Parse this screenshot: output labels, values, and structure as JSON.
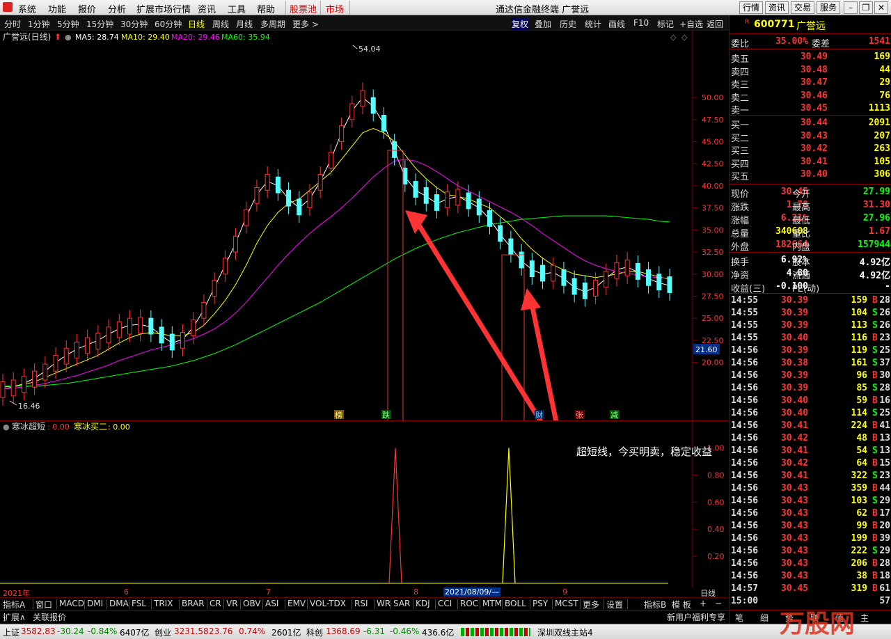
{
  "menubar": {
    "items": [
      "系统",
      "功能",
      "报价",
      "分析",
      "扩展市场行情",
      "资讯",
      "工具",
      "帮助",
      "股票池",
      "市场"
    ],
    "window_title": "通达信金融终端  广誉远",
    "right_buttons": [
      "行情",
      "资讯",
      "交易",
      "服务"
    ]
  },
  "toolbar": {
    "periods": [
      "分时",
      "1分钟",
      "5分钟",
      "15分钟",
      "30分钟",
      "60分钟",
      "日线",
      "周线",
      "月线",
      "多周期",
      "更多 >"
    ],
    "selected_period": "日线",
    "tools": [
      "复权",
      "叠加",
      "历史",
      "统计",
      "画线",
      "F10",
      "+自选",
      "返回"
    ]
  },
  "main_chart": {
    "title": "广誉远(日线)",
    "ma5": "MA5: 28.74",
    "ma10": "MA10: 29.40",
    "ma20": "MA20: 29.46",
    "ma60": "MA60: 35.94",
    "high_label": "54.04",
    "low_label": "16.46",
    "current_price_tag": "21.60",
    "time_labels": [
      "2021年",
      "6",
      "7",
      "8",
      "9"
    ],
    "event_labels": [
      "榜",
      "跌",
      "财",
      "张",
      "减"
    ],
    "annotation": "超短线，今买明卖，稳定收益",
    "date_cursor": "2021/08/09/—"
  },
  "chart_data": [
    {
      "type": "candlestick",
      "title": "广誉远(日线)",
      "ylim": [
        15,
        56
      ],
      "y_ticks": [
        20.0,
        22.5,
        25.0,
        27.5,
        30.0,
        32.5,
        35.0,
        37.5,
        40.0,
        42.5,
        45.0,
        47.5,
        50.0
      ],
      "series": [
        {
          "name": "MA5",
          "values": [
            17.0,
            17.2,
            17.6,
            18.2,
            19.0,
            20.0,
            20.8,
            21.5,
            22.0,
            22.5,
            23.2,
            23.8,
            24.2,
            24.3,
            24.0,
            23.0,
            22.2,
            22.6,
            24.0,
            26.0,
            28.5,
            31.0,
            33.5,
            36.5,
            39.0,
            40.5,
            40.0,
            38.5,
            37.5,
            38.5,
            40.5,
            43.0,
            46.0,
            48.5,
            50.0,
            49.0,
            47.0,
            44.0,
            41.0,
            39.5,
            38.8,
            38.0,
            38.5,
            38.8,
            38.2,
            37.5,
            36.2,
            34.5,
            33.0,
            31.5,
            30.5,
            30.0,
            30.2,
            29.5,
            28.5,
            28.0,
            28.5,
            29.5,
            30.5,
            30.8,
            30.2,
            29.5,
            29.0,
            28.7
          ]
        },
        {
          "name": "MA10",
          "values": [
            17.2,
            17.3,
            17.5,
            17.8,
            18.3,
            18.8,
            19.3,
            19.8,
            20.3,
            20.8,
            21.5,
            22.2,
            22.8,
            23.2,
            23.4,
            23.2,
            23.0,
            23.0,
            23.4,
            24.2,
            25.5,
            27.0,
            28.8,
            31.0,
            33.5,
            35.5,
            37.0,
            38.0,
            38.5,
            39.5,
            40.5,
            41.5,
            43.0,
            44.5,
            46.0,
            46.5,
            46.0,
            45.0,
            43.5,
            42.0,
            40.8,
            39.8,
            39.0,
            38.8,
            38.5,
            38.0,
            37.5,
            36.5,
            35.5,
            34.0,
            32.8,
            31.8,
            31.0,
            30.5,
            30.0,
            29.8,
            29.6,
            29.8,
            30.0,
            30.3,
            30.3,
            30.0,
            29.7,
            29.4
          ]
        },
        {
          "name": "MA20",
          "values": [
            17.0,
            17.1,
            17.2,
            17.4,
            17.6,
            17.9,
            18.2,
            18.5,
            18.9,
            19.3,
            19.7,
            20.2,
            20.6,
            21.0,
            21.4,
            21.7,
            22.0,
            22.3,
            22.7,
            23.2,
            23.8,
            24.6,
            25.6,
            26.8,
            28.2,
            29.6,
            31.0,
            32.3,
            33.5,
            34.6,
            35.6,
            36.5,
            37.5,
            38.6,
            39.8,
            41.0,
            42.0,
            42.8,
            43.0,
            42.8,
            42.3,
            41.6,
            40.8,
            40.0,
            39.4,
            38.8,
            38.2,
            37.6,
            37.0,
            36.3,
            35.5,
            34.6,
            33.8,
            33.0,
            32.2,
            31.5,
            31.0,
            30.6,
            30.3,
            30.1,
            29.9,
            29.7,
            29.6,
            29.5
          ]
        },
        {
          "name": "MA60",
          "values": [
            17.3,
            17.3,
            17.3,
            17.3,
            17.4,
            17.5,
            17.6,
            17.8,
            18.0,
            18.2,
            18.4,
            18.6,
            18.8,
            19.0,
            19.2,
            19.4,
            19.6,
            19.9,
            20.2,
            20.6,
            21.0,
            21.5,
            22.0,
            22.6,
            23.2,
            23.8,
            24.4,
            25.0,
            25.6,
            26.2,
            26.8,
            27.5,
            28.2,
            28.9,
            29.6,
            30.3,
            31.0,
            31.7,
            32.3,
            32.9,
            33.4,
            33.9,
            34.3,
            34.7,
            35.0,
            35.3,
            35.6,
            35.8,
            36.0,
            36.2,
            36.3,
            36.4,
            36.5,
            36.6,
            36.6,
            36.6,
            36.6,
            36.6,
            36.5,
            36.4,
            36.3,
            36.2,
            36.0,
            35.9
          ]
        }
      ]
    },
    {
      "type": "line",
      "title": "寒冰超短",
      "ylim": [
        0,
        1.1
      ],
      "y_ticks": [
        0.2,
        0.4,
        0.6,
        0.8,
        1.0
      ],
      "series": [
        {
          "name": "寒冰超短",
          "values": [
            0,
            0,
            0,
            0,
            0,
            0,
            0,
            0,
            0,
            0,
            0,
            0,
            0,
            0,
            0,
            0,
            0,
            0,
            0,
            0,
            0,
            0,
            0,
            0,
            0,
            0,
            0,
            0,
            0,
            0,
            0,
            0,
            0,
            0,
            0,
            0,
            0,
            0,
            1,
            0,
            0,
            0,
            0,
            0,
            0,
            0,
            0,
            0,
            0,
            0,
            0,
            0,
            0,
            0,
            0,
            0,
            0,
            0,
            0,
            0,
            0,
            0,
            0,
            0
          ]
        },
        {
          "name": "寒冰买二",
          "values": [
            0,
            0,
            0,
            0,
            0,
            0,
            0,
            0,
            0,
            0,
            0,
            0,
            0,
            0,
            0,
            0,
            0,
            0,
            0,
            0,
            0,
            0,
            0,
            0,
            0,
            0,
            0,
            0,
            0,
            0,
            0,
            0,
            0,
            0,
            0,
            0,
            0,
            0,
            0,
            0,
            0,
            0,
            0,
            0,
            0,
            0,
            0,
            0,
            0,
            0,
            1,
            0,
            0,
            0,
            0,
            0,
            0,
            0,
            0,
            0,
            0,
            0,
            0,
            0
          ]
        }
      ]
    }
  ],
  "indicator": {
    "name": "寒冰超短",
    "val1": ": 0.00",
    "name2": "寒冰买二",
    "val2": ": 0.00"
  },
  "tabs": [
    "指标A",
    "窗口",
    "MACD",
    "DMI",
    "DMA",
    "FSL",
    "TRIX",
    "BRAR",
    "CR",
    "VR",
    "OBV",
    "ASI",
    "EMV",
    "VOL-TDX",
    "RSI",
    "WR",
    "SAR",
    "KDJ",
    "CCI",
    "ROC",
    "MTM",
    "BOLL",
    "PSY",
    "MCST",
    "更多",
    "设置"
  ],
  "tabs_right": [
    "指标B",
    "模 板",
    "+",
    "−"
  ],
  "tabs2": [
    "扩展∧",
    "关联报价"
  ],
  "tab_period": "日线",
  "tab_promo": "新用户福利专享",
  "right_panel": {
    "code": "600771",
    "name": "广誉远",
    "weibi_label": "委比",
    "weibi": "35.00%",
    "weicha_label": "委差",
    "weicha": "1541",
    "asks": [
      {
        "label": "卖五",
        "price": "30.49",
        "vol": "169"
      },
      {
        "label": "卖四",
        "price": "30.48",
        "vol": "44"
      },
      {
        "label": "卖三",
        "price": "30.47",
        "vol": "29"
      },
      {
        "label": "卖二",
        "price": "30.46",
        "vol": "76"
      },
      {
        "label": "卖一",
        "price": "30.45",
        "vol": "1113"
      }
    ],
    "bids": [
      {
        "label": "买一",
        "price": "30.44",
        "vol": "2091"
      },
      {
        "label": "买二",
        "price": "30.43",
        "vol": "207"
      },
      {
        "label": "买三",
        "price": "30.42",
        "vol": "263"
      },
      {
        "label": "买四",
        "price": "30.41",
        "vol": "105"
      },
      {
        "label": "买五",
        "price": "30.40",
        "vol": "306"
      }
    ],
    "stats": [
      {
        "l1": "现价",
        "v1": "30.45",
        "c1": "red",
        "l2": "今开",
        "v2": "27.99",
        "c2": "green"
      },
      {
        "l1": "涨跌",
        "v1": "1.78",
        "c1": "red",
        "l2": "最高",
        "v2": "31.30",
        "c2": "red"
      },
      {
        "l1": "涨幅",
        "v1": "6.21%",
        "c1": "red",
        "l2": "最低",
        "v2": "27.96",
        "c2": "green"
      },
      {
        "l1": "总量",
        "v1": "340608",
        "c1": "yellow",
        "l2": "量比",
        "v2": "1.67",
        "c2": "red"
      },
      {
        "l1": "外盘",
        "v1": "182664",
        "c1": "red",
        "l2": "内盘",
        "v2": "157944",
        "c2": "green"
      }
    ],
    "stats2": [
      {
        "l1": "换手",
        "v1": "6.92%",
        "l2": "股本",
        "v2": "4.92亿"
      },
      {
        "l1": "净资",
        "v1": "4.80",
        "l2": "流通",
        "v2": "4.92亿"
      },
      {
        "l1": "收益(三)",
        "v1": "-0.100",
        "l2": "PE(动)",
        "v2": "-"
      }
    ],
    "ticks": [
      {
        "t": "14:55",
        "p": "30.39",
        "v": "159",
        "bs": "B",
        "n": "28"
      },
      {
        "t": "14:55",
        "p": "30.39",
        "v": "104",
        "bs": "S",
        "n": "26"
      },
      {
        "t": "14:55",
        "p": "30.39",
        "v": "113",
        "bs": "S",
        "n": "26"
      },
      {
        "t": "14:55",
        "p": "30.40",
        "v": "116",
        "bs": "B",
        "n": "23"
      },
      {
        "t": "14:56",
        "p": "30.39",
        "v": "119",
        "bs": "S",
        "n": "25"
      },
      {
        "t": "14:56",
        "p": "30.38",
        "v": "161",
        "bs": "S",
        "n": "37"
      },
      {
        "t": "14:56",
        "p": "30.39",
        "v": "96",
        "bs": "B",
        "n": "30"
      },
      {
        "t": "14:56",
        "p": "30.39",
        "v": "85",
        "bs": "S",
        "n": "28"
      },
      {
        "t": "14:56",
        "p": "30.40",
        "v": "59",
        "bs": "B",
        "n": "16"
      },
      {
        "t": "14:56",
        "p": "30.40",
        "v": "114",
        "bs": "S",
        "n": "25"
      },
      {
        "t": "14:56",
        "p": "30.41",
        "v": "224",
        "bs": "B",
        "n": "41"
      },
      {
        "t": "14:56",
        "p": "30.42",
        "v": "48",
        "bs": "B",
        "n": "13"
      },
      {
        "t": "14:56",
        "p": "30.41",
        "v": "54",
        "bs": "S",
        "n": "13"
      },
      {
        "t": "14:56",
        "p": "30.42",
        "v": "64",
        "bs": "B",
        "n": "15"
      },
      {
        "t": "14:56",
        "p": "30.41",
        "v": "322",
        "bs": "S",
        "n": "23"
      },
      {
        "t": "14:56",
        "p": "30.43",
        "v": "359",
        "bs": "B",
        "n": "44"
      },
      {
        "t": "14:56",
        "p": "30.43",
        "v": "103",
        "bs": "S",
        "n": "29"
      },
      {
        "t": "14:56",
        "p": "30.43",
        "v": "62",
        "bs": "B",
        "n": "17"
      },
      {
        "t": "14:56",
        "p": "30.43",
        "v": "99",
        "bs": "B",
        "n": "20"
      },
      {
        "t": "14:56",
        "p": "30.43",
        "v": "199",
        "bs": "B",
        "n": "39"
      },
      {
        "t": "14:56",
        "p": "30.43",
        "v": "222",
        "bs": "S",
        "n": "29"
      },
      {
        "t": "14:56",
        "p": "30.43",
        "v": "206",
        "bs": "B",
        "n": "28"
      },
      {
        "t": "14:56",
        "p": "30.43",
        "v": "38",
        "bs": "B",
        "n": "18"
      },
      {
        "t": "14:57",
        "p": "30.45",
        "v": "319",
        "bs": "B",
        "n": "61"
      },
      {
        "t": "15:00",
        "p": "",
        "v": "",
        "bs": "",
        "n": "57"
      }
    ],
    "bottom_tabs": [
      "笔",
      "细",
      "势",
      "联",
      "值",
      "主"
    ]
  },
  "statusbar": {
    "sh_label": "上证",
    "sh_val": "3582.83",
    "sh_chg": "-30.24",
    "sh_pct": "-0.84%",
    "sh_amt": "6407亿",
    "cy_label": "创业",
    "cy_val": "3231.58",
    "cy_chg": "23.76",
    "cy_pct": "0.74%",
    "cy_amt": "2601亿",
    "kc_label": "科创",
    "kc_val": "1368.69",
    "kc_chg": "-6.31",
    "kc_pct": "-0.46%",
    "kc_amt": "436.6亿",
    "server": "深圳双线主站4"
  },
  "watermark": "万股网",
  "colors": {
    "up": "#ff3333",
    "down": "#54ffff",
    "ma5": "#ffffff",
    "ma10": "#ffff00",
    "ma20": "#ff00ff",
    "ma60": "#00ff00",
    "frame": "#880000"
  }
}
